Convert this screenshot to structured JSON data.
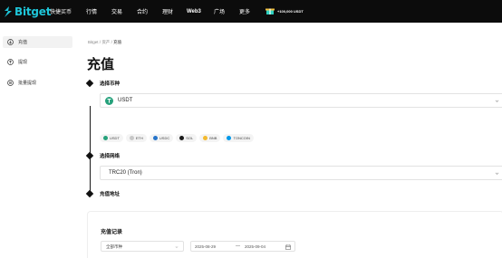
{
  "brand": {
    "name": "Bitget",
    "accent": "#1ec5d8"
  },
  "topnav": {
    "items": [
      "快捷买币",
      "行情",
      "交易",
      "合约",
      "理财",
      "Web3",
      "广场",
      "更多"
    ],
    "promo": "+100,000 USDT"
  },
  "sidebar": {
    "items": [
      {
        "label": "充值",
        "icon": "deposit-icon",
        "active": true
      },
      {
        "label": "提现",
        "icon": "withdraw-icon",
        "active": false
      },
      {
        "label": "批量提现",
        "icon": "batch-withdraw-icon",
        "active": false
      }
    ]
  },
  "breadcrumb": {
    "home": "Bitget",
    "sep": "/",
    "assets": "资产",
    "current": "充值"
  },
  "page": {
    "title": "充值"
  },
  "steps": {
    "coin": {
      "label": "选择币种",
      "selected": "USDT",
      "chips": [
        {
          "label": "USDT",
          "color": "#26a17b"
        },
        {
          "label": "ETH",
          "color": "#c8c8c8"
        },
        {
          "label": "USDC",
          "color": "#2775ca"
        },
        {
          "label": "SOL",
          "color": "#1a1a1a"
        },
        {
          "label": "BNB",
          "color": "#f3ba2f"
        },
        {
          "label": "TONCOIN",
          "color": "#0098ea"
        }
      ]
    },
    "network": {
      "label": "选择网络",
      "selected": "TRC20 (Tron)"
    },
    "address": {
      "label": "充值地址"
    }
  },
  "records": {
    "title": "充值记录",
    "coin_filter": "全部币种",
    "date_start": "2025-08-29",
    "date_sep": "—",
    "date_end": "2025-09-04"
  }
}
